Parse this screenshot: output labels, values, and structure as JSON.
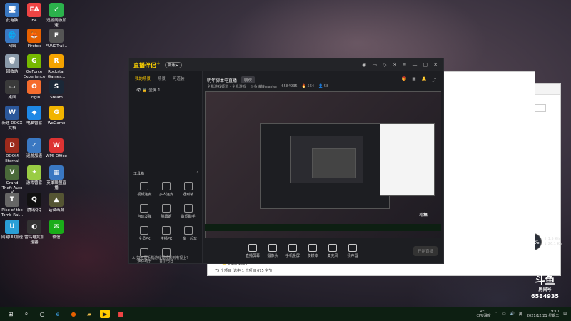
{
  "desktop": {
    "icons": [
      {
        "label": "此电脑",
        "glyph": "🖥",
        "color": "#3a78c2"
      },
      {
        "label": "EA",
        "glyph": "EA",
        "color": "#e44"
      },
      {
        "label": "迅游网游加速",
        "glyph": "✓",
        "color": "#2bb24c"
      },
      {
        "label": "网络",
        "glyph": "🌐",
        "color": "#3a78c2"
      },
      {
        "label": "Firefox",
        "glyph": "🦊",
        "color": "#e66000"
      },
      {
        "label": "FUNGTrai...",
        "glyph": "F",
        "color": "#555"
      },
      {
        "label": "回收站",
        "glyph": "🗑",
        "color": "#8a9aaa"
      },
      {
        "label": "GeForce Experience",
        "glyph": "G",
        "color": "#76b900"
      },
      {
        "label": "Rockstar Games...",
        "glyph": "R",
        "color": "#f5a300"
      },
      {
        "label": "桌面",
        "glyph": "▭",
        "color": "#3a3a3a"
      },
      {
        "label": "Origin",
        "glyph": "O",
        "color": "#f56c2d"
      },
      {
        "label": "Steam",
        "glyph": "S",
        "color": "#1b2838"
      },
      {
        "label": "新建 DOCX 文档",
        "glyph": "W",
        "color": "#2b579a"
      },
      {
        "label": "电脑管家",
        "glyph": "◆",
        "color": "#1e88e5"
      },
      {
        "label": "WeGame",
        "glyph": "G",
        "color": "#f2b400"
      },
      {
        "label": "DOOM Eternal",
        "glyph": "D",
        "color": "#9c2a1c"
      },
      {
        "label": "迅游加速",
        "glyph": "✓",
        "color": "#3a78c2"
      },
      {
        "label": "WPS Office",
        "glyph": "W",
        "color": "#d33"
      },
      {
        "label": "Grand Theft Auto V",
        "glyph": "V",
        "color": "#4a6a3a"
      },
      {
        "label": "游戏管家",
        "glyph": "✦",
        "color": "#9c4"
      },
      {
        "label": "英雄联盟直播",
        "glyph": "▦",
        "color": "#3a78c2"
      },
      {
        "label": "Rise of the Tomb Rai...",
        "glyph": "T",
        "color": "#666"
      },
      {
        "label": "腾讯QQ",
        "glyph": "Q",
        "color": "#111"
      },
      {
        "label": "话试画廊",
        "glyph": "▲",
        "color": "#553"
      },
      {
        "label": "网易UU加速",
        "glyph": "U",
        "color": "#2a9fd6"
      },
      {
        "label": "雷鸟电竞加速器",
        "glyph": "◐",
        "color": "#333"
      },
      {
        "label": "微信",
        "glyph": "✉",
        "color": "#1aad19"
      }
    ]
  },
  "app": {
    "logo": "直播伴侣",
    "logo_plus": "+",
    "badge": "新版 ▸",
    "left_tabs": [
      "我的场景",
      "场景",
      "可道装"
    ],
    "scene_name": "全屏 1",
    "tools_title": "工具箱",
    "tools": [
      "视频连麦",
      "多人连麦",
      "遇到装",
      "自动发弹",
      "弹幕姬",
      "数词助手",
      "全员PK",
      "主播PK",
      "上车一起玩",
      "推荐助手",
      "音乐电台"
    ],
    "footer_tip": "如何把手机游戏视频搬到电视上?",
    "room_title": "明年脚本电直播",
    "tag": "剧说",
    "sub_tags": [
      "全机游戏频道 · 全机游戏"
    ],
    "streamer": "斗鱼娘娘master",
    "room_id": "6584935",
    "fans": "564",
    "viewers": "58",
    "bottom_tools": [
      "直播屏幕",
      "摄像头",
      "手机投屏",
      "多媒体",
      "麦克风",
      "扬声器"
    ],
    "start_label": "开始直播"
  },
  "explorer": {
    "folder_label": "Trash-1000",
    "count_label": "75 个项目",
    "select_label": "选中 1 个项目  675 字节"
  },
  "speed_meter": {
    "value": "29",
    "unit": "%",
    "up": "1.5 K/s",
    "down": "26.1 K/s"
  },
  "watermark": {
    "brand": "斗鱼",
    "sub": "房间号",
    "room": "6584935"
  },
  "taskbar": {
    "weather": "4°C",
    "cpu_label": "CPU温度",
    "time": "19:10",
    "date": "2021/12/21 星期二"
  },
  "colors": {
    "accent": "#ffcc00",
    "taskbar": "#0d1f12",
    "window": "#1d1e22"
  }
}
